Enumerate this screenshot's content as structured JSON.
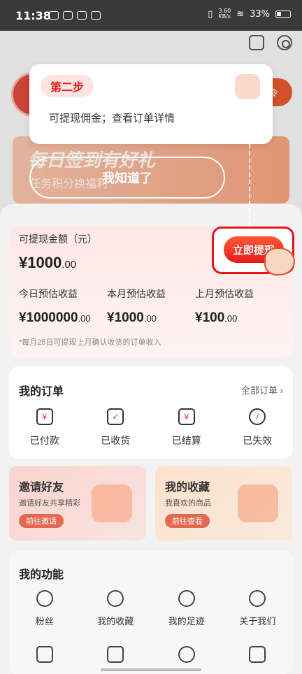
{
  "status_bar": {
    "time": "11:38",
    "net_speed": "3.60\nKB/s",
    "battery": "33%"
  },
  "header": {
    "invite_fragment": "令"
  },
  "banner": {
    "title": "每日签到有好礼",
    "subtitle": "任务积分换福利"
  },
  "earnings": {
    "label": "可提现金额（元）",
    "amount_int": "¥1000",
    "amount_dec": ".00",
    "withdraw_label": "立即提现",
    "stats": [
      {
        "label": "今日预估收益",
        "int": "¥1000000",
        "dec": ".00"
      },
      {
        "label": "本月预估收益",
        "int": "¥1000",
        "dec": ".00"
      },
      {
        "label": "上月预估收益",
        "int": "¥100",
        "dec": ".00"
      }
    ],
    "note": "*每月25日可提现上月确认收货的订单收入"
  },
  "orders": {
    "title": "我的订单",
    "all_label": "全部订单 ›",
    "items": [
      {
        "label": "已付款",
        "icon": "paid-icon"
      },
      {
        "label": "已收货",
        "icon": "received-icon"
      },
      {
        "label": "已结算",
        "icon": "settled-icon"
      },
      {
        "label": "已失效",
        "icon": "expired-icon"
      }
    ]
  },
  "promo": {
    "invite": {
      "title": "邀请好友",
      "subtitle": "邀请好友共享精彩",
      "button": "前往邀请"
    },
    "favorites": {
      "title": "我的收藏",
      "subtitle": "我喜欢的商品",
      "button": "前往查看"
    }
  },
  "functions": {
    "title": "我的功能",
    "items": [
      {
        "label": "粉丝",
        "icon": "fans-icon"
      },
      {
        "label": "我的收藏",
        "icon": "star-icon"
      },
      {
        "label": "我的足迹",
        "icon": "flag-icon"
      },
      {
        "label": "关于我们",
        "icon": "info-icon"
      }
    ]
  },
  "tooltip": {
    "step": "第二步",
    "text": "可提现佣金；查看订单详情",
    "dismiss": "我知道了"
  },
  "colors": {
    "accent": "#e5322d",
    "highlight_border": "#e41518"
  }
}
